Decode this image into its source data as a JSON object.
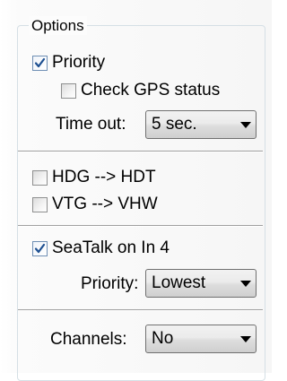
{
  "options_group": {
    "title": "Options"
  },
  "priority": {
    "label": "Priority",
    "checked": true
  },
  "check_gps": {
    "label": "Check GPS status",
    "checked": false
  },
  "timeout": {
    "label": "Time out:",
    "value": "5 sec."
  },
  "hdg_hdt": {
    "label": "HDG --> HDT",
    "checked": false
  },
  "vtg_vhw": {
    "label": "VTG --> VHW",
    "checked": false
  },
  "seatalk": {
    "label": "SeaTalk on In 4",
    "checked": true
  },
  "seatalk_priority": {
    "label": "Priority:",
    "value": "Lowest"
  },
  "channels": {
    "label": "Channels:",
    "value": "No"
  },
  "colors": {
    "check_mark": "#1d4f91",
    "separator": "#a0a0a0",
    "group_border": "#d5dfe5"
  }
}
